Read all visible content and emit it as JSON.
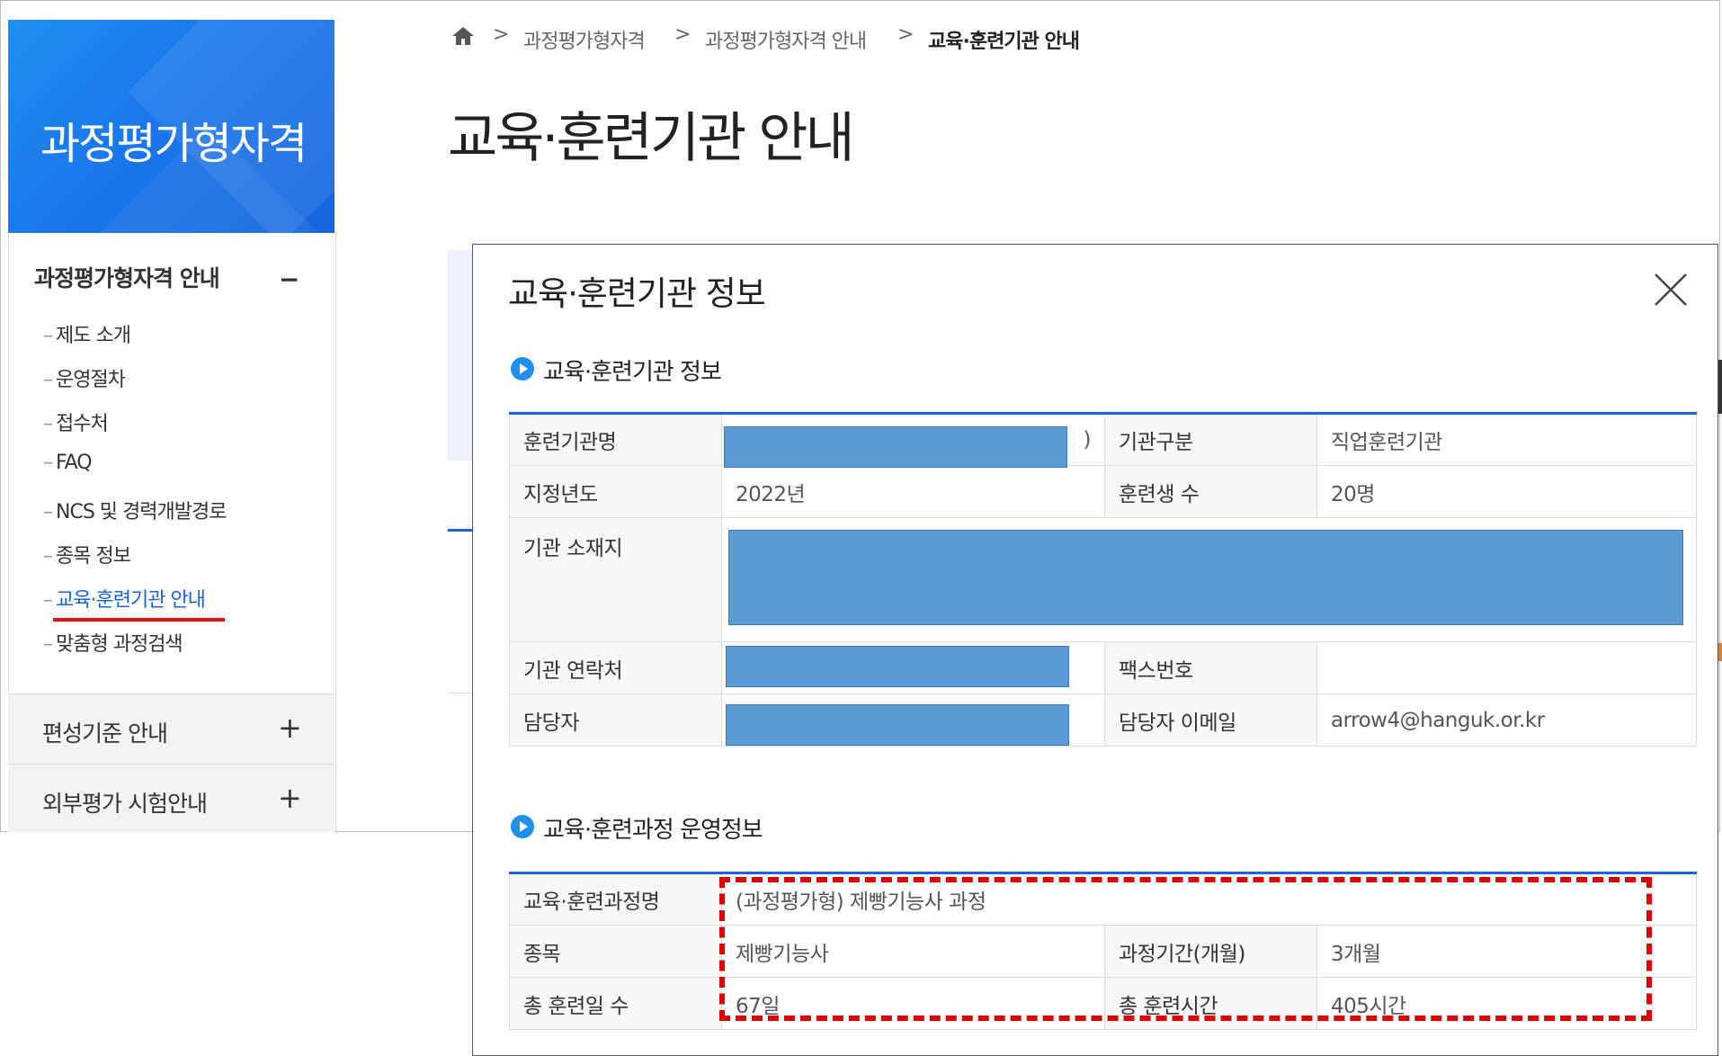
{
  "sidebar": {
    "banner_title": "과정평가형자격",
    "section_title": "과정평가형자격 안내",
    "collapse_symbol": "−",
    "items": [
      {
        "dash": "–",
        "label": "제도 소개"
      },
      {
        "dash": "–",
        "label": "운영절차"
      },
      {
        "dash": "–",
        "label": "접수처"
      },
      {
        "dash": "–",
        "label": "FAQ"
      },
      {
        "dash": "–",
        "label": "NCS 및 경력개발경로"
      },
      {
        "dash": "–",
        "label": "종목 정보"
      },
      {
        "dash": "–",
        "label": "교육·훈련기관 안내",
        "active": true
      },
      {
        "dash": "–",
        "label": "맞춤형 과정검색"
      }
    ],
    "sections": [
      {
        "label": "편성기준 안내",
        "symbol": "+"
      },
      {
        "label": "외부평가 시험안내",
        "symbol": "+"
      }
    ]
  },
  "breadcrumb": {
    "home_icon": "home-icon",
    "separator": ">",
    "items": [
      "과정평가형자격",
      "과정평가형자격 안내",
      "교육·훈련기관 안내"
    ]
  },
  "page_title": "교육·훈련기관 안내",
  "modal": {
    "title": "교육·훈련기관 정보",
    "close_icon": "close-icon",
    "section1_title": "교육·훈련기관 정보",
    "section2_title": "교육·훈련과정 운영정보",
    "institution": {
      "name_label": "훈련기관명",
      "name_value_tail": ")",
      "type_label": "기관구분",
      "type_value": "직업훈련기관",
      "year_label": "지정년도",
      "year_value": "2022년",
      "trainees_label": "훈련생 수",
      "trainees_value": "20명",
      "address_label": "기관 소재지",
      "contact_label": "기관 연락처",
      "fax_label": "팩스번호",
      "fax_value": "",
      "manager_label": "담당자",
      "email_label": "담당자 이메일",
      "email_value": "arrow4@hanguk.or.kr"
    },
    "course": {
      "name_label": "교육·훈련과정명",
      "name_value": "(과정평가형) 제빵기능사 과정",
      "item_label": "종목",
      "item_value": "제빵기능사",
      "period_label": "과정기간(개월)",
      "period_value": "3개월",
      "days_label": "총 훈련일 수",
      "days_value": "67일",
      "hours_label": "총 훈련시간",
      "hours_value": "405시간"
    }
  },
  "colors": {
    "brand_blue": "#1a77ea",
    "link_blue": "#1a64d8",
    "redaction": "#5b9bd5",
    "highlight_red": "#e00000"
  }
}
